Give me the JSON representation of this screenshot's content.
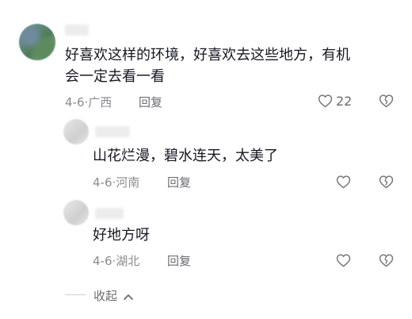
{
  "main_comment": {
    "text_line1": "好喜欢这样的环境，好喜欢去这些地方，有机",
    "text_line2": "会一定去看一看",
    "date": "4-6",
    "location": "广西",
    "reply_label": "回复",
    "like_count": "22"
  },
  "replies": [
    {
      "text": "山花烂漫，碧水连天，太美了",
      "date": "4-6",
      "location": "河南",
      "reply_label": "回复"
    },
    {
      "text": "好地方呀",
      "date": "4-6",
      "location": "湖北",
      "reply_label": "回复"
    }
  ],
  "collapse_label": "收起",
  "icons": {
    "like": "heart-outline-icon",
    "dislike": "broken-heart-icon",
    "collapse": "chevron-up-icon"
  },
  "colors": {
    "text": "#161823",
    "meta": "#8a8b91",
    "action": "#6b6c72"
  }
}
